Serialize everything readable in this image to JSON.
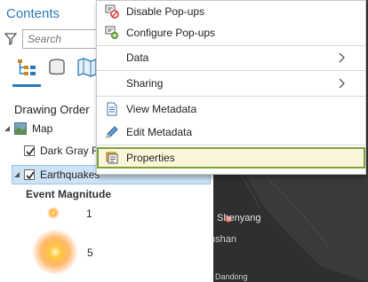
{
  "pane": {
    "title": "Contents",
    "search_placeholder": "Search",
    "section_title": "Drawing Order",
    "tree": {
      "map_label": "Map",
      "basemap_label": "Dark Gray R",
      "layer_label": "Earthquakes"
    },
    "legend": {
      "heading": "Event Magnitude",
      "items": [
        {
          "label": "1"
        },
        {
          "label": "5"
        }
      ]
    }
  },
  "map": {
    "labels": [
      "Shenyang",
      "nshan",
      "Dandong"
    ]
  },
  "context_menu": {
    "items": [
      {
        "label": "Disable Pop-ups",
        "icon": "disable-popups-icon"
      },
      {
        "label": "Configure Pop-ups",
        "icon": "configure-popups-icon"
      },
      {
        "label": "Data",
        "submenu": true
      },
      {
        "label": "Sharing",
        "submenu": true
      },
      {
        "label": "View Metadata",
        "icon": "view-metadata-icon"
      },
      {
        "label": "Edit Metadata",
        "icon": "edit-metadata-icon"
      },
      {
        "label": "Properties",
        "icon": "properties-icon",
        "highlighted": true
      }
    ]
  },
  "colors": {
    "accent": "#2a7ab8",
    "selection": "#cde3f5",
    "highlight_border": "#7aa23c",
    "map_background": "#2b2b2b"
  }
}
